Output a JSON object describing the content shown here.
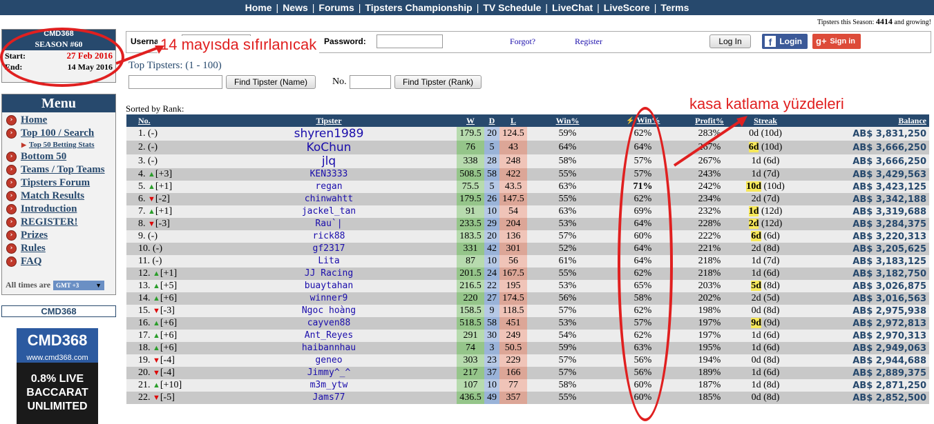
{
  "nav": [
    "Home",
    "News",
    "Forums",
    "Tipsters Championship",
    "TV Schedule",
    "LiveChat",
    "LiveScore",
    "Terms"
  ],
  "tipcount": {
    "prefix": "Tipsters this Season:",
    "count": "4414",
    "suffix": "and growing!"
  },
  "season": {
    "logo": "CMD368",
    "title": "SEASON #60",
    "start_label": "Start:",
    "start": "27 Feb 2016",
    "end_label": "End:",
    "end": "14 May 2016"
  },
  "menu": {
    "title": "Menu",
    "items": [
      {
        "label": "Home",
        "type": "main"
      },
      {
        "label": "Top 100 / Search",
        "type": "main"
      },
      {
        "label": "Top 50 Betting Stats",
        "type": "sub"
      },
      {
        "label": "Bottom 50",
        "type": "main"
      },
      {
        "label": "Teams / Top Teams",
        "type": "main"
      },
      {
        "label": "Tipsters Forum",
        "type": "main"
      },
      {
        "label": "Match Results",
        "type": "main"
      },
      {
        "label": "Introduction",
        "type": "main"
      },
      {
        "label": "REGISTER!",
        "type": "main"
      },
      {
        "label": "Prizes",
        "type": "main"
      },
      {
        "label": "Rules",
        "type": "main"
      },
      {
        "label": "FAQ",
        "type": "main"
      }
    ],
    "times_label": "All times are",
    "timezone": "GMT +3"
  },
  "ads": {
    "banner": "CMD368",
    "logo": "CMD368",
    "url": "www.cmd368.com",
    "line1": "0.8% LIVE",
    "line2": "BACCARAT",
    "line3": "UNLIMITED"
  },
  "login": {
    "username_label": "Username:",
    "password_label": "Password:",
    "forgot": "Forgot?",
    "register": "Register",
    "login_btn": "Log In",
    "fb_btn": "Login",
    "gp_btn": "Sign in"
  },
  "search": {
    "title": "Top Tipsters: (1 - 100)",
    "find_name": "Find Tipster (Name)",
    "no_label": "No.",
    "find_rank": "Find Tipster (Rank)",
    "sorted": "Sorted by Rank:"
  },
  "table": {
    "headers": [
      "No.",
      "Tipster",
      "W",
      "D",
      "L",
      "Win%",
      "Win%",
      "Profit%",
      "Streak",
      "Balance"
    ],
    "rows": [
      {
        "rank": "1.",
        "move": "(-)",
        "dir": "",
        "name": "shyren1989",
        "big": true,
        "w": "179.5",
        "d": "20",
        "l": "124.5",
        "win": "59%",
        "win2": "62%",
        "bold2": false,
        "profit": "283%",
        "streak": "0d",
        "streak_hl": false,
        "streak2": "(10d)",
        "bal": "AB$ 3,831,250"
      },
      {
        "rank": "2.",
        "move": "(-)",
        "dir": "",
        "name": "KoChun",
        "big": true,
        "w": "76",
        "d": "5",
        "l": "43",
        "win": "64%",
        "win2": "64%",
        "bold2": false,
        "profit": "267%",
        "streak": "6d",
        "streak_hl": true,
        "streak2": "(10d)",
        "bal": "AB$ 3,666,250"
      },
      {
        "rank": "3.",
        "move": "(-)",
        "dir": "",
        "name": "jlq",
        "big": true,
        "w": "338",
        "d": "28",
        "l": "248",
        "win": "58%",
        "win2": "57%",
        "bold2": false,
        "profit": "267%",
        "streak": "1d",
        "streak_hl": false,
        "streak2": "(6d)",
        "bal": "AB$ 3,666,250"
      },
      {
        "rank": "4.",
        "move": "[+3]",
        "dir": "up",
        "name": "KEN3333",
        "big": false,
        "w": "508.5",
        "d": "58",
        "l": "422",
        "win": "55%",
        "win2": "57%",
        "bold2": false,
        "profit": "243%",
        "streak": "1d",
        "streak_hl": false,
        "streak2": "(7d)",
        "bal": "AB$ 3,429,563"
      },
      {
        "rank": "5.",
        "move": "[+1]",
        "dir": "up",
        "name": "regan",
        "big": false,
        "w": "75.5",
        "d": "5",
        "l": "43.5",
        "win": "63%",
        "win2": "71%",
        "bold2": true,
        "profit": "242%",
        "streak": "10d",
        "streak_hl": true,
        "streak2": "(10d)",
        "bal": "AB$ 3,423,125"
      },
      {
        "rank": "6.",
        "move": "[-2]",
        "dir": "dn",
        "name": "chinwahtt",
        "big": false,
        "w": "179.5",
        "d": "26",
        "l": "147.5",
        "win": "55%",
        "win2": "62%",
        "bold2": false,
        "profit": "234%",
        "streak": "2d",
        "streak_hl": false,
        "streak2": "(7d)",
        "bal": "AB$ 3,342,188"
      },
      {
        "rank": "7.",
        "move": "[+1]",
        "dir": "up",
        "name": "jackel_tan",
        "big": false,
        "w": "91",
        "d": "10",
        "l": "54",
        "win": "63%",
        "win2": "69%",
        "bold2": false,
        "profit": "232%",
        "streak": "1d",
        "streak_hl": true,
        "streak2": "(12d)",
        "bal": "AB$ 3,319,688"
      },
      {
        "rank": "8.",
        "move": "[-3]",
        "dir": "dn",
        "name": "Rau`|",
        "big": false,
        "w": "233.5",
        "d": "29",
        "l": "204",
        "win": "53%",
        "win2": "64%",
        "bold2": false,
        "profit": "228%",
        "streak": "2d",
        "streak_hl": true,
        "streak2": "(12d)",
        "bal": "AB$ 3,284,375"
      },
      {
        "rank": "9.",
        "move": "(-)",
        "dir": "",
        "name": "rick88",
        "big": false,
        "w": "183.5",
        "d": "20",
        "l": "136",
        "win": "57%",
        "win2": "60%",
        "bold2": false,
        "profit": "222%",
        "streak": "6d",
        "streak_hl": true,
        "streak2": "(6d)",
        "bal": "AB$ 3,220,313"
      },
      {
        "rank": "10.",
        "move": "(-)",
        "dir": "",
        "name": "gf2317",
        "big": false,
        "w": "331",
        "d": "42",
        "l": "301",
        "win": "52%",
        "win2": "64%",
        "bold2": false,
        "profit": "221%",
        "streak": "2d",
        "streak_hl": false,
        "streak2": "(8d)",
        "bal": "AB$ 3,205,625"
      },
      {
        "rank": "11.",
        "move": "(-)",
        "dir": "",
        "name": "Lita",
        "big": false,
        "w": "87",
        "d": "10",
        "l": "56",
        "win": "61%",
        "win2": "64%",
        "bold2": false,
        "profit": "218%",
        "streak": "1d",
        "streak_hl": false,
        "streak2": "(7d)",
        "bal": "AB$ 3,183,125"
      },
      {
        "rank": "12.",
        "move": "[+1]",
        "dir": "up",
        "name": "JJ Racing",
        "big": false,
        "w": "201.5",
        "d": "24",
        "l": "167.5",
        "win": "55%",
        "win2": "62%",
        "bold2": false,
        "profit": "218%",
        "streak": "1d",
        "streak_hl": false,
        "streak2": "(6d)",
        "bal": "AB$ 3,182,750"
      },
      {
        "rank": "13.",
        "move": "[+5]",
        "dir": "up",
        "name": "buaytahan",
        "big": false,
        "w": "216.5",
        "d": "22",
        "l": "195",
        "win": "53%",
        "win2": "65%",
        "bold2": false,
        "profit": "203%",
        "streak": "5d",
        "streak_hl": true,
        "streak2": "(8d)",
        "bal": "AB$ 3,026,875"
      },
      {
        "rank": "14.",
        "move": "[+6]",
        "dir": "up",
        "name": "winner9",
        "big": false,
        "w": "220",
        "d": "27",
        "l": "174.5",
        "win": "56%",
        "win2": "58%",
        "bold2": false,
        "profit": "202%",
        "streak": "2d",
        "streak_hl": false,
        "streak2": "(5d)",
        "bal": "AB$ 3,016,563"
      },
      {
        "rank": "15.",
        "move": "[-3]",
        "dir": "dn",
        "name": "Ngoc hoàng",
        "big": false,
        "w": "158.5",
        "d": "9",
        "l": "118.5",
        "win": "57%",
        "win2": "62%",
        "bold2": false,
        "profit": "198%",
        "streak": "0d",
        "streak_hl": false,
        "streak2": "(8d)",
        "bal": "AB$ 2,975,938"
      },
      {
        "rank": "16.",
        "move": "[+6]",
        "dir": "up",
        "name": "cayven88",
        "big": false,
        "w": "518.5",
        "d": "58",
        "l": "451",
        "win": "53%",
        "win2": "57%",
        "bold2": false,
        "profit": "197%",
        "streak": "9d",
        "streak_hl": true,
        "streak2": "(9d)",
        "bal": "AB$ 2,972,813"
      },
      {
        "rank": "17.",
        "move": "[+6]",
        "dir": "up",
        "name": "Ant_Reyes",
        "big": false,
        "w": "291",
        "d": "30",
        "l": "249",
        "win": "54%",
        "win2": "62%",
        "bold2": false,
        "profit": "197%",
        "streak": "1d",
        "streak_hl": false,
        "streak2": "(6d)",
        "bal": "AB$ 2,970,313"
      },
      {
        "rank": "18.",
        "move": "[+6]",
        "dir": "up",
        "name": "haibannhau",
        "big": false,
        "w": "74",
        "d": "3",
        "l": "50.5",
        "win": "59%",
        "win2": "63%",
        "bold2": false,
        "profit": "195%",
        "streak": "1d",
        "streak_hl": false,
        "streak2": "(6d)",
        "bal": "AB$ 2,949,063"
      },
      {
        "rank": "19.",
        "move": "[-4]",
        "dir": "dn",
        "name": "geneo",
        "big": false,
        "w": "303",
        "d": "23",
        "l": "229",
        "win": "57%",
        "win2": "56%",
        "bold2": false,
        "profit": "194%",
        "streak": "0d",
        "streak_hl": false,
        "streak2": "(8d)",
        "bal": "AB$ 2,944,688"
      },
      {
        "rank": "20.",
        "move": "[-4]",
        "dir": "dn",
        "name": "Jimmy^_^",
        "big": false,
        "w": "217",
        "d": "37",
        "l": "166",
        "win": "57%",
        "win2": "56%",
        "bold2": false,
        "profit": "189%",
        "streak": "1d",
        "streak_hl": false,
        "streak2": "(6d)",
        "bal": "AB$ 2,889,375"
      },
      {
        "rank": "21.",
        "move": "[+10]",
        "dir": "up",
        "name": "m3m_ytw",
        "big": false,
        "w": "107",
        "d": "10",
        "l": "77",
        "win": "58%",
        "win2": "60%",
        "bold2": false,
        "profit": "187%",
        "streak": "1d",
        "streak_hl": false,
        "streak2": "(8d)",
        "bal": "AB$ 2,871,250"
      },
      {
        "rank": "22.",
        "move": "[-5]",
        "dir": "dn",
        "name": "Jams77",
        "big": false,
        "w": "436.5",
        "d": "49",
        "l": "357",
        "win": "55%",
        "win2": "60%",
        "bold2": false,
        "profit": "185%",
        "streak": "0d",
        "streak_hl": false,
        "streak2": "(8d)",
        "bal": "AB$ 2,852,500"
      }
    ]
  },
  "annotations": {
    "reset_note": "14 mayısda sıfırlanıcak",
    "profit_note": "kasa katlama yüzdeleri",
    "color": "#e02020"
  }
}
